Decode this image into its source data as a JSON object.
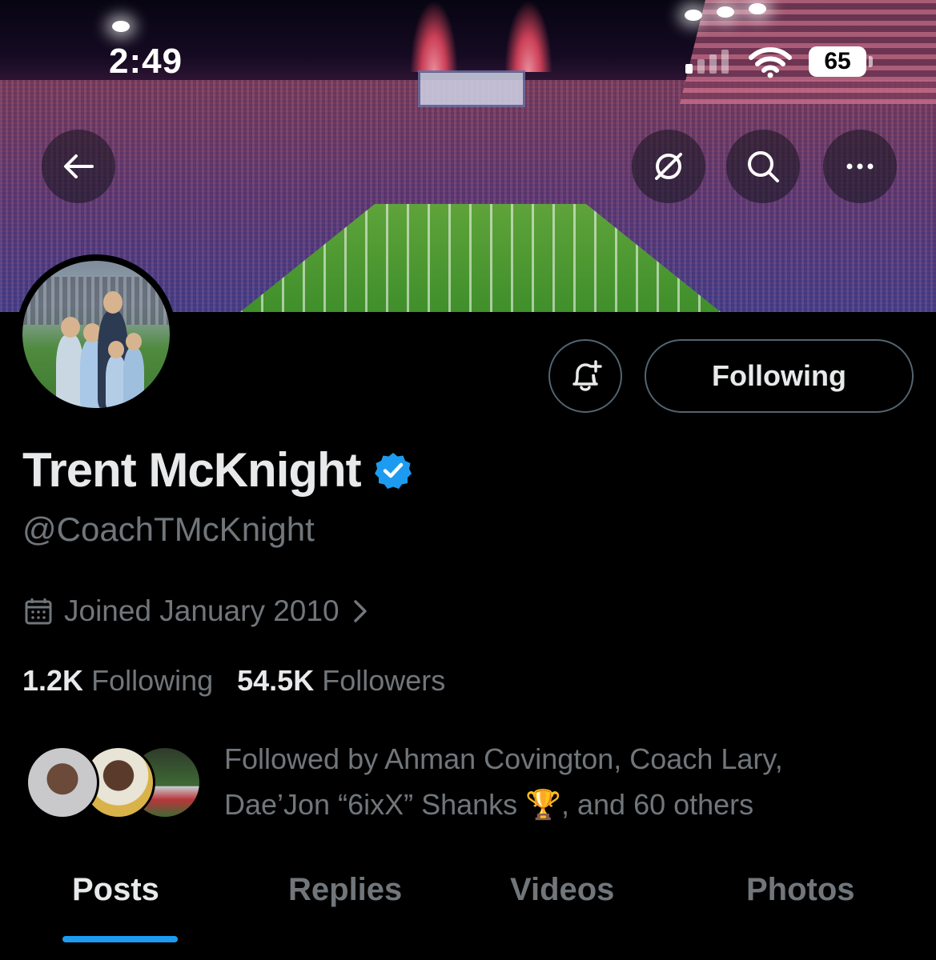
{
  "status_bar": {
    "time": "2:49",
    "battery": "65"
  },
  "banner": {
    "description_icons": [
      "back-arrow-icon",
      "translate-off-icon",
      "search-icon",
      "more-icon"
    ]
  },
  "profile": {
    "display_name": "Trent McKnight",
    "handle": "@CoachTMcKnight",
    "joined": "Joined January 2010",
    "following_count": "1.2K",
    "following_label": "Following",
    "followers_count": "54.5K",
    "followers_label": "Followers"
  },
  "actions": {
    "following_button": "Following"
  },
  "followed_by": {
    "line1": "Followed by Ahman Covington, Coach Lary,",
    "line2_prefix": "Dae’Jon “6ixX” Shanks ",
    "emoji": "🏆",
    "line2_suffix": ", and 60 others"
  },
  "tabs": [
    {
      "label": "Posts",
      "active": true
    },
    {
      "label": "Replies",
      "active": false
    },
    {
      "label": "Videos",
      "active": false
    },
    {
      "label": "Photos",
      "active": false
    }
  ],
  "colors": {
    "accent": "#1d9bf0",
    "verified": "#1d9bf0",
    "secondary_text": "#71767b",
    "primary_text": "#e7e9ea",
    "background": "#000000"
  }
}
